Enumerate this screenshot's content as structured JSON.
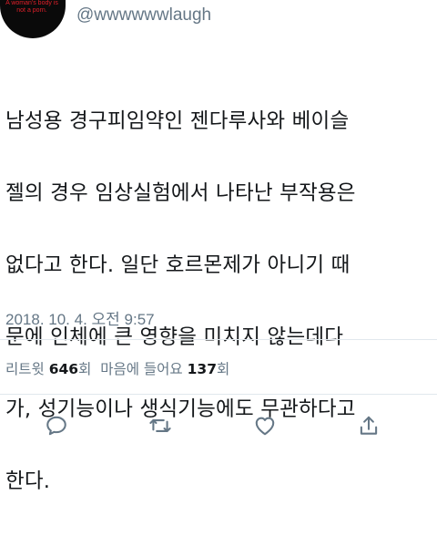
{
  "tweet": {
    "display_name": "",
    "handle": "@wwwwwwlaugh",
    "avatar_text": "A woman's body is not a porn.",
    "text_lines": [
      "남성용 경구피임약인 젠다루사와 베이슬",
      "젤의 경우 임상실험에서 나타난 부작용은",
      "없다고 한다. 일단 호르몬제가 아니기 때",
      "문에 인체에 큰 영향을 미치지 않는데다",
      "가, 성기능이나 생식기능에도 무관하다고",
      "한다."
    ],
    "timestamp": "2018. 10. 4. 오전 9:57",
    "retweets_label": "리트윗",
    "retweets_count": "646",
    "retweets_unit": "회",
    "likes_label": "마음에 들어요",
    "likes_count": "137",
    "likes_unit": "회"
  },
  "actions": [
    {
      "name": "reply",
      "icon": "reply-icon"
    },
    {
      "name": "retweet",
      "icon": "retweet-icon"
    },
    {
      "name": "like",
      "icon": "heart-icon"
    },
    {
      "name": "share",
      "icon": "share-icon"
    }
  ],
  "colors": {
    "text": "#14171a",
    "secondary": "#657786",
    "divider": "#e1e8ed",
    "avatar_bg": "#0a0a0a",
    "avatar_text": "#e0202a"
  }
}
